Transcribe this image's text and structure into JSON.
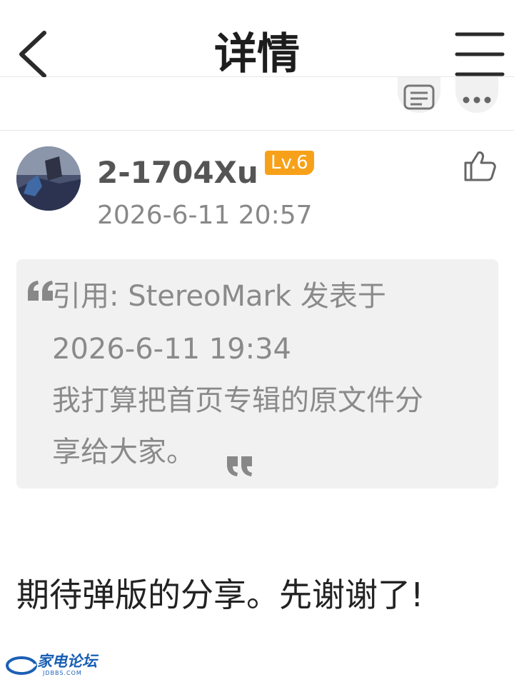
{
  "header": {
    "title": "详情",
    "back_icon": "chevron-left-icon",
    "menu_icon": "menu-icon"
  },
  "actions": {
    "reply_icon": "comment-list-icon",
    "more_icon": "more-dots-icon"
  },
  "post": {
    "username": "2-1704Xu",
    "level": "Lv.6",
    "time": "2026-6-11 20:57",
    "like_icon": "thumbs-up-icon",
    "quote": {
      "line1": "引用: StereoMark 发表于",
      "line2": "2026-6-11 19:34",
      "line3": "我打算把首页专辑的原文件分",
      "line4": "享给大家。"
    },
    "body": "期待弹版的分享。先谢谢了!"
  },
  "watermark": {
    "name": "家电论坛",
    "domain": "JDBBS.COM"
  },
  "colors": {
    "level_badge": "#f7a11a",
    "quote_bg": "#f1f1f1",
    "watermark": "#1a5fb4"
  }
}
